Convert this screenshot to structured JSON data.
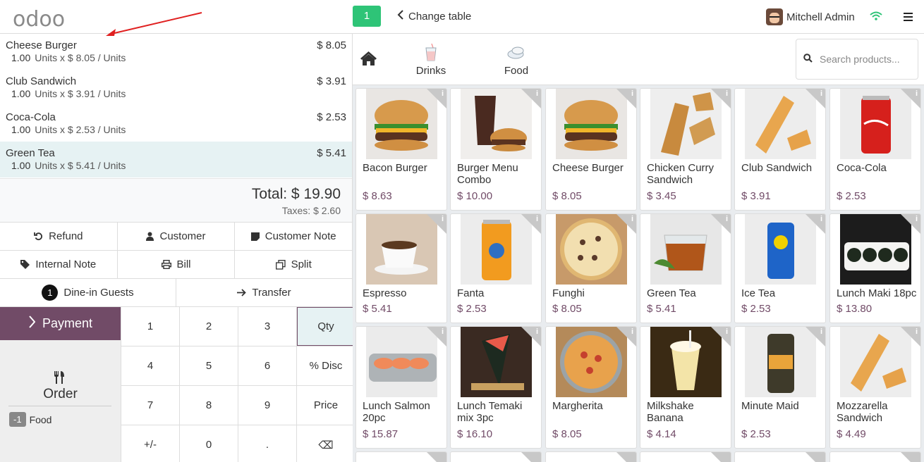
{
  "header": {
    "logo": "odoo",
    "table_number": "1",
    "change_table": "Change table",
    "user_name": "Mitchell Admin"
  },
  "orderlines": [
    {
      "name": "Cheese Burger",
      "price": "$ 8.05",
      "qty": "1.00",
      "detail": "Units x $ 8.05 / Units",
      "selected": false
    },
    {
      "name": "Club Sandwich",
      "price": "$ 3.91",
      "qty": "1.00",
      "detail": "Units x $ 3.91 / Units",
      "selected": false
    },
    {
      "name": "Coca-Cola",
      "price": "$ 2.53",
      "qty": "1.00",
      "detail": "Units x $ 2.53 / Units",
      "selected": false
    },
    {
      "name": "Green Tea",
      "price": "$ 5.41",
      "qty": "1.00",
      "detail": "Units x $ 5.41 / Units",
      "selected": true
    }
  ],
  "totals": {
    "total": "Total: $ 19.90",
    "taxes": "Taxes: $ 2.60"
  },
  "controls": {
    "refund": "Refund",
    "customer": "Customer",
    "customer_note": "Customer Note",
    "internal_note": "Internal Note",
    "bill": "Bill",
    "split": "Split",
    "guests_count": "1",
    "guests": "Dine-in Guests",
    "transfer": "Transfer"
  },
  "payment": {
    "label": "Payment"
  },
  "order_panel": {
    "label": "Order",
    "category_badge": "-1",
    "category_name": "Food"
  },
  "numpad": {
    "keys": [
      "1",
      "2",
      "3",
      "Qty",
      "4",
      "5",
      "6",
      "% Disc",
      "7",
      "8",
      "9",
      "Price",
      "+/-",
      "0",
      ".",
      "⌫"
    ],
    "active": "Qty"
  },
  "categories": {
    "items": [
      {
        "label": "Drinks"
      },
      {
        "label": "Food"
      }
    ],
    "search_placeholder": "Search products..."
  },
  "products": [
    {
      "name": "Bacon Burger",
      "price": "$ 8.63",
      "img": "burger"
    },
    {
      "name": "Burger Menu Combo",
      "price": "$ 10.00",
      "img": "combo"
    },
    {
      "name": "Cheese Burger",
      "price": "$ 8.05",
      "img": "burger"
    },
    {
      "name": "Chicken Curry Sandwich",
      "price": "$ 3.45",
      "img": "sandwich"
    },
    {
      "name": "Club Sandwich",
      "price": "$ 3.91",
      "img": "baguette"
    },
    {
      "name": "Coca-Cola",
      "price": "$ 2.53",
      "img": "coke"
    },
    {
      "name": "Espresso",
      "price": "$ 5.41",
      "img": "espresso"
    },
    {
      "name": "Fanta",
      "price": "$ 2.53",
      "img": "fanta"
    },
    {
      "name": "Funghi",
      "price": "$ 8.05",
      "img": "pizza"
    },
    {
      "name": "Green Tea",
      "price": "$ 5.41",
      "img": "tea"
    },
    {
      "name": "Ice Tea",
      "price": "$ 2.53",
      "img": "icetea"
    },
    {
      "name": "Lunch Maki 18pc",
      "price": "$ 13.80",
      "img": "maki"
    },
    {
      "name": "Lunch Salmon 20pc",
      "price": "$ 15.87",
      "img": "salmon"
    },
    {
      "name": "Lunch Temaki mix 3pc",
      "price": "$ 16.10",
      "img": "temaki"
    },
    {
      "name": "Margherita",
      "price": "$ 8.05",
      "img": "pizza2"
    },
    {
      "name": "Milkshake Banana",
      "price": "$ 4.14",
      "img": "milkshake"
    },
    {
      "name": "Minute Maid",
      "price": "$ 2.53",
      "img": "minutemaid"
    },
    {
      "name": "Mozzarella Sandwich",
      "price": "$ 4.49",
      "img": "baguette"
    }
  ],
  "colors": {
    "brand": "#714b67",
    "table_badge": "#2ec477",
    "selected_line": "#e6f2f3",
    "annotation_arrow": "#e02020"
  }
}
